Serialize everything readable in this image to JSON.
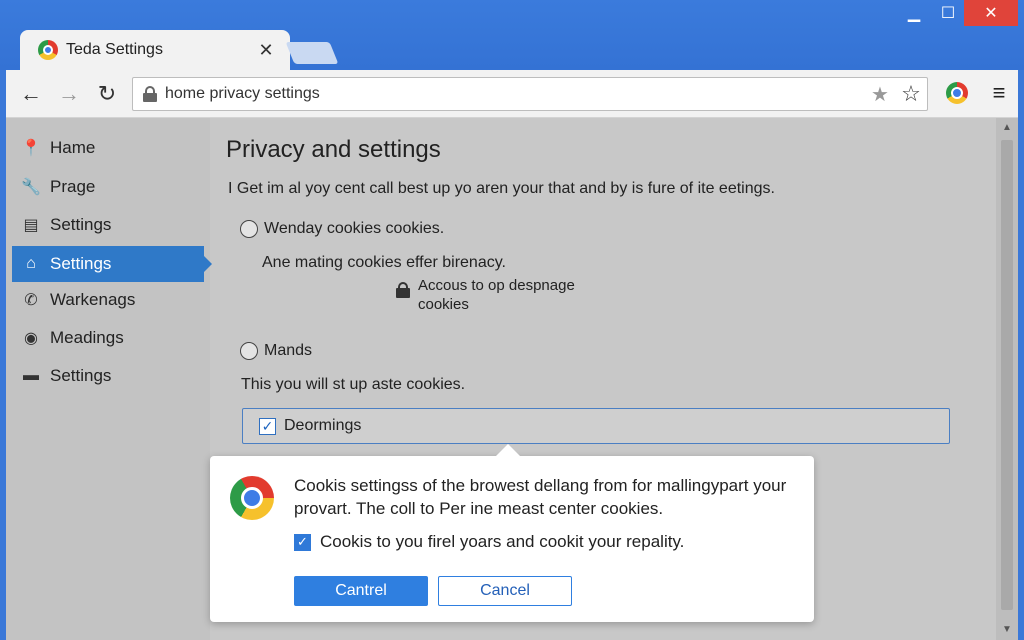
{
  "window": {
    "tab_title": "Teda Settings",
    "tab_close": "✕",
    "min": "▁",
    "max": "☐",
    "close": "✕"
  },
  "toolbar": {
    "back": "←",
    "forward": "→",
    "reload": "↻",
    "url": "home privacy settings",
    "star_grey": "★",
    "star_outline": "☆",
    "menu": "≡"
  },
  "sidebar": {
    "items": [
      {
        "label": "Hame",
        "icon": "map-pin-icon",
        "glyph": "📍"
      },
      {
        "label": "Prage",
        "icon": "wrench-icon",
        "glyph": "🔧"
      },
      {
        "label": "Settings",
        "icon": "document-icon",
        "glyph": "▤"
      },
      {
        "label": "Settings",
        "icon": "home-icon",
        "glyph": "⌂",
        "active": true
      },
      {
        "label": "Warkenags",
        "icon": "phone-icon",
        "glyph": "✆"
      },
      {
        "label": "Meadings",
        "icon": "globe-icon",
        "glyph": "◉"
      },
      {
        "label": "Settings",
        "icon": "folder-icon",
        "glyph": "▬"
      }
    ]
  },
  "content": {
    "title": "Privacy and settings",
    "description": "I Get im al yoy cent call best up yo aren your that and by is fure of ite eetings.",
    "option1": {
      "label": "Wenday cookies cookies.",
      "selected": false
    },
    "option1_sub": "Ane mating cookies effer birenacy.",
    "option1_lock_text": "Accous to op despnage cookies",
    "option2": {
      "label": "Mands",
      "selected": false
    },
    "option2_sub": "This you will st up aste cookies.",
    "checkbox": {
      "label": "Deormings",
      "checked": true,
      "mark": "✓"
    }
  },
  "popup": {
    "message": "Cookis settingss of the browest dellang from for mallingypart your provart. The coll to Per ine meast center cookies.",
    "checkbox_label": "Cookis to you firel yoars and cookit your repality.",
    "checkbox_mark": "✓",
    "primary_button": "Cantrel",
    "secondary_button": "Cancel"
  },
  "scrollbar": {
    "up": "▲",
    "down": "▼"
  },
  "colors": {
    "titlebar": "#3b7bdc",
    "active_nav": "#2f79c8",
    "primary_button": "#2f7fe0",
    "close_button": "#e0443a"
  }
}
